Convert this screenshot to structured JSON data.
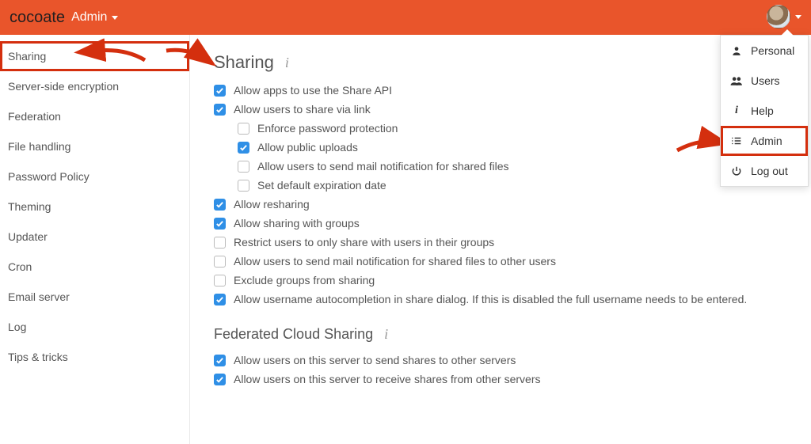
{
  "header": {
    "brand": "cocoate",
    "admin_label": "Admin"
  },
  "sidebar": {
    "items": [
      "Sharing",
      "Server-side encryption",
      "Federation",
      "File handling",
      "Password Policy",
      "Theming",
      "Updater",
      "Cron",
      "Email server",
      "Log",
      "Tips & tricks"
    ]
  },
  "main": {
    "title": "Sharing",
    "options": {
      "allow_share_api": "Allow apps to use the Share API",
      "share_via_link": "Allow users to share via link",
      "enforce_pw": "Enforce password protection",
      "public_uploads": "Allow public uploads",
      "mail_notif_shared": "Allow users to send mail notification for shared files",
      "default_expire": "Set default expiration date",
      "allow_reshare": "Allow resharing",
      "share_groups": "Allow sharing with groups",
      "restrict_own_groups": "Restrict users to only share with users in their groups",
      "mail_notif_other": "Allow users to send mail notification for shared files to other users",
      "exclude_groups": "Exclude groups from sharing",
      "autocomplete": "Allow username autocompletion in share dialog. If this is disabled the full username needs to be entered."
    },
    "federated_title": "Federated Cloud Sharing",
    "federated": {
      "send_other_servers": "Allow users on this server to send shares to other servers",
      "receive_other_servers": "Allow users on this server to receive shares from other servers"
    }
  },
  "usermenu": {
    "personal": "Personal",
    "users": "Users",
    "help": "Help",
    "admin": "Admin",
    "logout": "Log out"
  }
}
